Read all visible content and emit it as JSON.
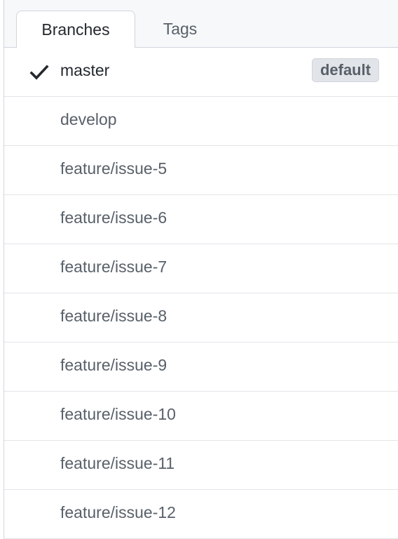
{
  "tabs": [
    {
      "label": "Branches",
      "active": true
    },
    {
      "label": "Tags",
      "active": false
    }
  ],
  "default_badge": "default",
  "branches": [
    {
      "name": "master",
      "selected": true
    },
    {
      "name": "develop"
    },
    {
      "name": "feature/issue-5"
    },
    {
      "name": "feature/issue-6"
    },
    {
      "name": "feature/issue-7"
    },
    {
      "name": "feature/issue-8"
    },
    {
      "name": "feature/issue-9"
    },
    {
      "name": "feature/issue-10"
    },
    {
      "name": "feature/issue-11"
    },
    {
      "name": "feature/issue-12"
    }
  ],
  "icons": {
    "selected": "check-icon"
  },
  "colors": {
    "text": "#24292e",
    "muted": "#586069",
    "border": "#d1d5da",
    "badge_bg": "#e1e4e8"
  }
}
